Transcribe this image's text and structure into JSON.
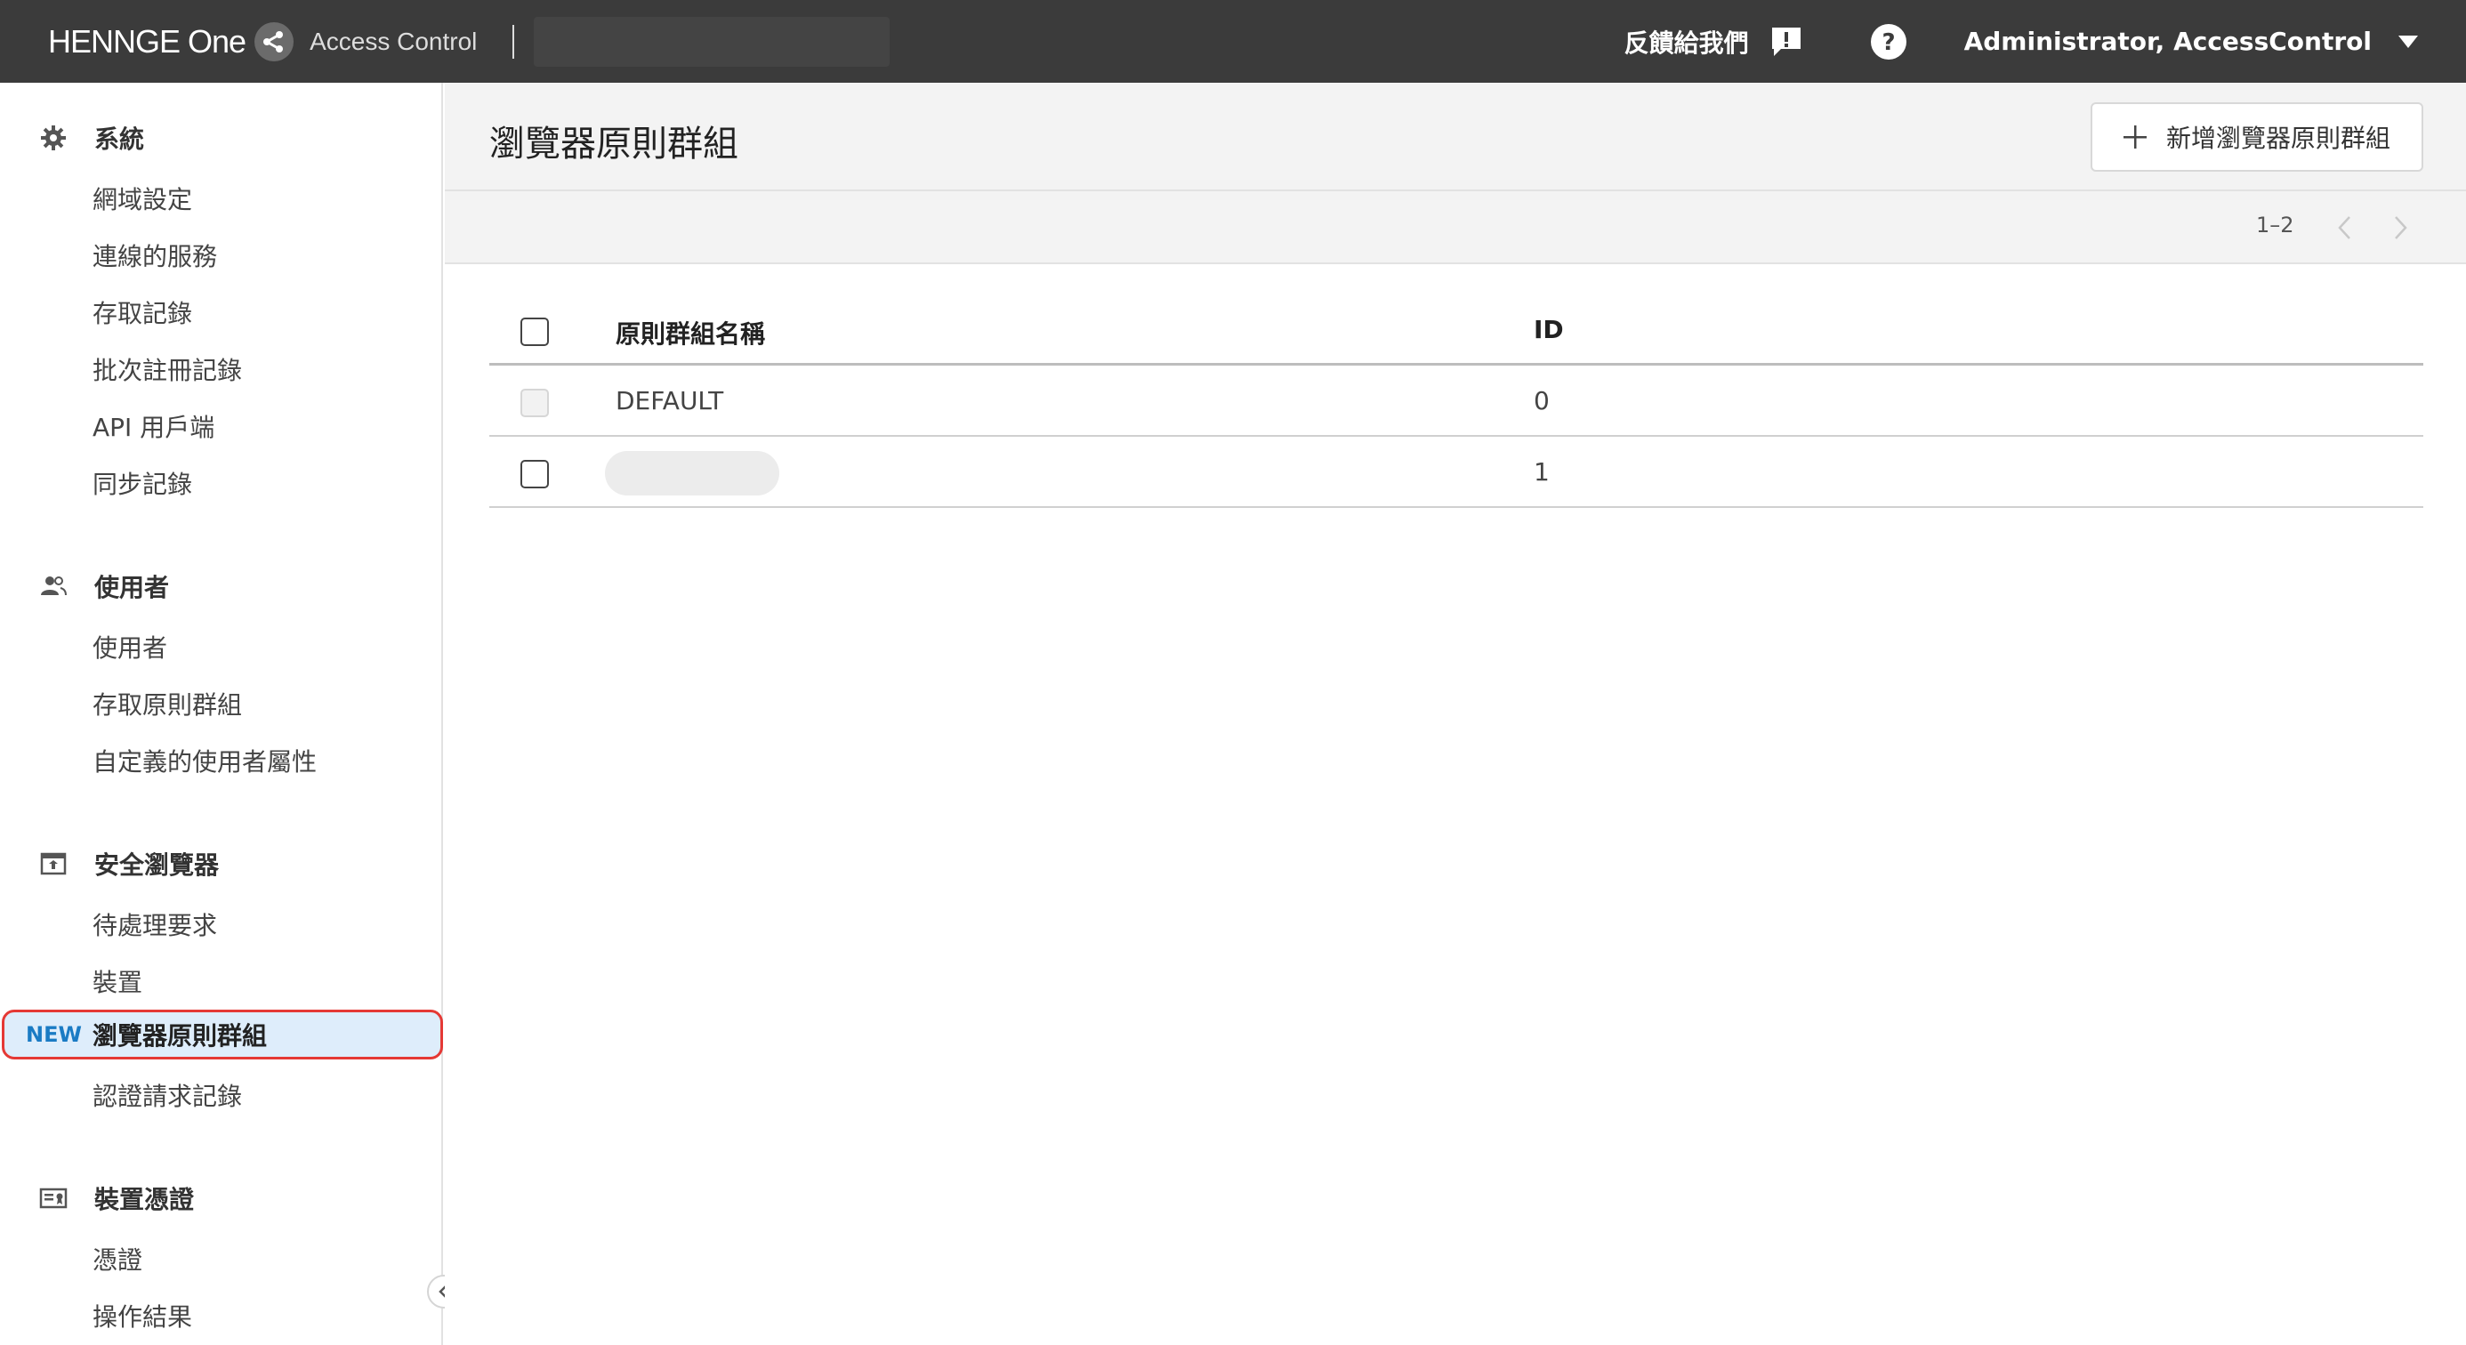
{
  "topbar": {
    "brand_text": "HENNGE One",
    "product_text": "Access Control",
    "feedback_label": "反饋給我們",
    "feedback_icon": "feedback-icon",
    "help_icon": "help-icon",
    "user_label": "Administrator, AccessControl",
    "user_caret_icon": "caret-down-icon"
  },
  "sidebar": {
    "sections": [
      {
        "title": "系統",
        "icon": "gear-icon",
        "items": [
          "網域設定",
          "連線的服務",
          "存取記錄",
          "批次註冊記錄",
          "API 用戶端",
          "同步記錄"
        ]
      },
      {
        "title": "使用者",
        "icon": "users-icon",
        "items": [
          "使用者",
          "存取原則群組",
          "自定義的使用者屬性"
        ]
      },
      {
        "title": "安全瀏覽器",
        "icon": "browser-icon",
        "items": [
          "待處理要求",
          "裝置",
          "瀏覽器原則群組",
          "認證請求記錄"
        ]
      },
      {
        "title": "裝置憑證",
        "icon": "certificate-icon",
        "items": [
          "憑證",
          "操作結果"
        ]
      }
    ],
    "active_item": {
      "badge": "NEW",
      "label": "瀏覽器原則群組"
    },
    "collapse_icon": "chevron-left-icon"
  },
  "main": {
    "page_title": "瀏覽器原則群組",
    "add_button_label": "新增瀏覽器原則群組",
    "pager": {
      "range": "1–2"
    },
    "table": {
      "columns": [
        "原則群組名稱",
        "ID"
      ],
      "rows": [
        {
          "name": "DEFAULT",
          "id": "0",
          "checkbox_disabled": true
        },
        {
          "name": "",
          "id": "1",
          "checkbox_disabled": false,
          "name_redacted": true
        }
      ]
    }
  },
  "colors": {
    "topbar_bg": "#3b3b3b",
    "active_bg": "#deedfb",
    "active_border": "#e53935",
    "new_badge": "#1a7bc4"
  }
}
